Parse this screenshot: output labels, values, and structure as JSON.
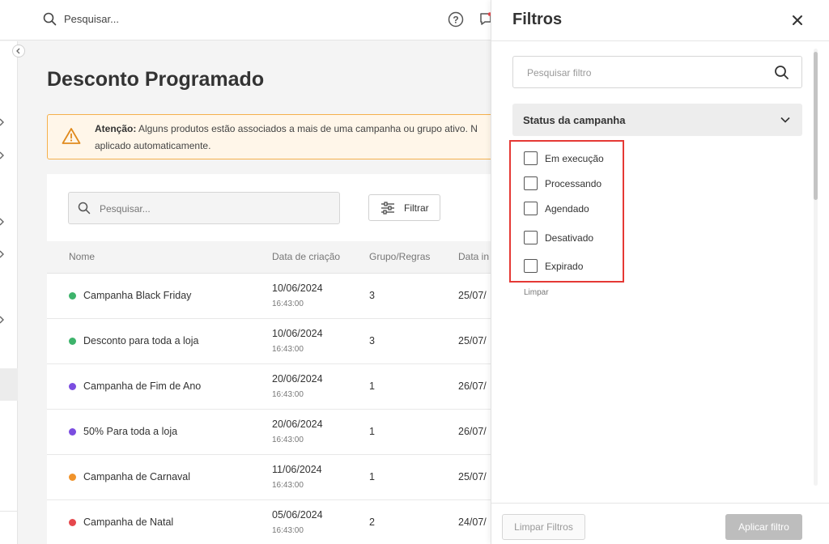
{
  "topbar": {
    "search_placeholder": "Pesquisar...",
    "icons": [
      "search-icon",
      "help-icon",
      "chat-icon"
    ]
  },
  "page": {
    "title": "Desconto Programado"
  },
  "alert": {
    "label": "Atenção:",
    "message": " Alguns produtos estão associados a mais de uma campanha ou grupo ativo. N",
    "message_line2": "aplicado automaticamente.",
    "color": "#f5b04c"
  },
  "toolbar": {
    "search_placeholder": "Pesquisar...",
    "filter_label": "Filtrar"
  },
  "table": {
    "columns": [
      "Nome",
      "Data de criação",
      "Grupo/Regras",
      "Data in"
    ],
    "rows": [
      {
        "name": "Campanha Black Friday",
        "date": "10/06/2024",
        "time": "16:43:00",
        "group": "3",
        "start": "25/07/",
        "status_color": "#3db36b"
      },
      {
        "name": "Desconto para toda a loja",
        "date": "10/06/2024",
        "time": "16:43:00",
        "group": "3",
        "start": "25/07/",
        "status_color": "#3db36b"
      },
      {
        "name": "Campanha de Fim de Ano",
        "date": "20/06/2024",
        "time": "16:43:00",
        "group": "1",
        "start": "26/07/",
        "status_color": "#7b4de0"
      },
      {
        "name": "50% Para toda a loja",
        "date": "20/06/2024",
        "time": "16:43:00",
        "group": "1",
        "start": "26/07/",
        "status_color": "#7b4de0"
      },
      {
        "name": "Campanha de Carnaval",
        "date": "11/06/2024",
        "time": "16:43:00",
        "group": "1",
        "start": "25/07/",
        "status_color": "#f0932b"
      },
      {
        "name": "Campanha de Natal",
        "date": "05/06/2024",
        "time": "16:43:00",
        "group": "2",
        "start": "24/07/",
        "status_color": "#e5484d"
      }
    ]
  },
  "drawer": {
    "title": "Filtros",
    "search_placeholder": "Pesquisar filtro",
    "section_title": "Status da campanha",
    "options": [
      "Em execução",
      "Processando",
      "Agendado",
      "Desativado",
      "Expirado"
    ],
    "clear_link": "Limpar",
    "clear_button": "Limpar Filtros",
    "apply_button": "Aplicar filtro",
    "highlight_color": "#e53935"
  }
}
